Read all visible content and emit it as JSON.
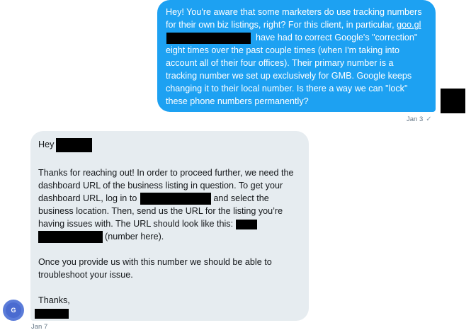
{
  "outgoing": {
    "lines": [
      "Hey! You're aware that some marketers do use tracking numbers",
      "for their own biz listings, right? For this client, in particular, ",
      "have had to correct Google's \"correction\"",
      "eight times over the past couple times (when I'm taking into",
      "account all of their four offices). Their primary number is a",
      "tracking number we set up exclusively for GMB. Google keeps",
      "changing it to their local number. Is there a way we can \"lock\"",
      "these phone numbers permanently?"
    ],
    "link_text": "goo.gl",
    "date": "Jan 3",
    "status_icon": "checkmark-icon"
  },
  "incoming": {
    "greeting": "Hey",
    "para1_line1": "Thanks for reaching out! In order to proceed further, we need the",
    "para1_line2": "dashboard URL of the business listing in question. To get your",
    "para1_line3_a": "dashboard URL, log in to",
    "para1_line3_b": "and select the",
    "para1_line4": "business location. Then, send us the URL for the listing you’re",
    "para1_line5": "having issues with. The URL should look like this:",
    "para1_line6": "(number here).",
    "para2_line1": "Once you provide us with this number we should be able to",
    "para2_line2": "troubleshoot your issue.",
    "signoff": "Thanks,",
    "avatar_letter": "G",
    "date": "Jan 7"
  },
  "colors": {
    "outgoing_bubble": "#1da1f2",
    "incoming_bubble": "#e6ecf0",
    "meta_text": "#657786"
  }
}
